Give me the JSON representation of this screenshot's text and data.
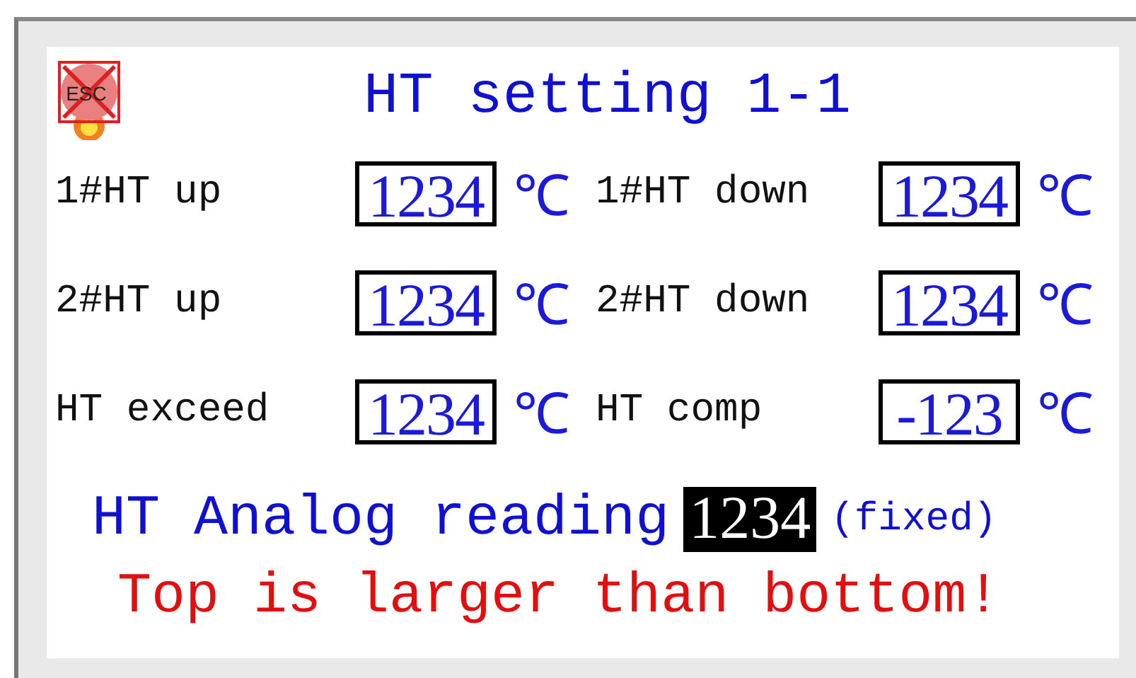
{
  "esc_button": {
    "label": "ESC"
  },
  "title": "HT setting 1-1",
  "settings": [
    {
      "label": "1#HT up",
      "value": "1234",
      "unit": "℃"
    },
    {
      "label": "1#HT down",
      "value": "1234",
      "unit": "℃"
    },
    {
      "label": "2#HT up",
      "value": "1234",
      "unit": "℃"
    },
    {
      "label": "2#HT down",
      "value": "1234",
      "unit": "℃"
    },
    {
      "label": "HT exceed",
      "value": "1234",
      "unit": "℃"
    },
    {
      "label": "HT comp",
      "value": "-123",
      "unit": "℃"
    }
  ],
  "analog": {
    "label": "HT Analog reading",
    "value": "1234",
    "note": "(fixed)"
  },
  "warning": "Top is larger than bottom!"
}
